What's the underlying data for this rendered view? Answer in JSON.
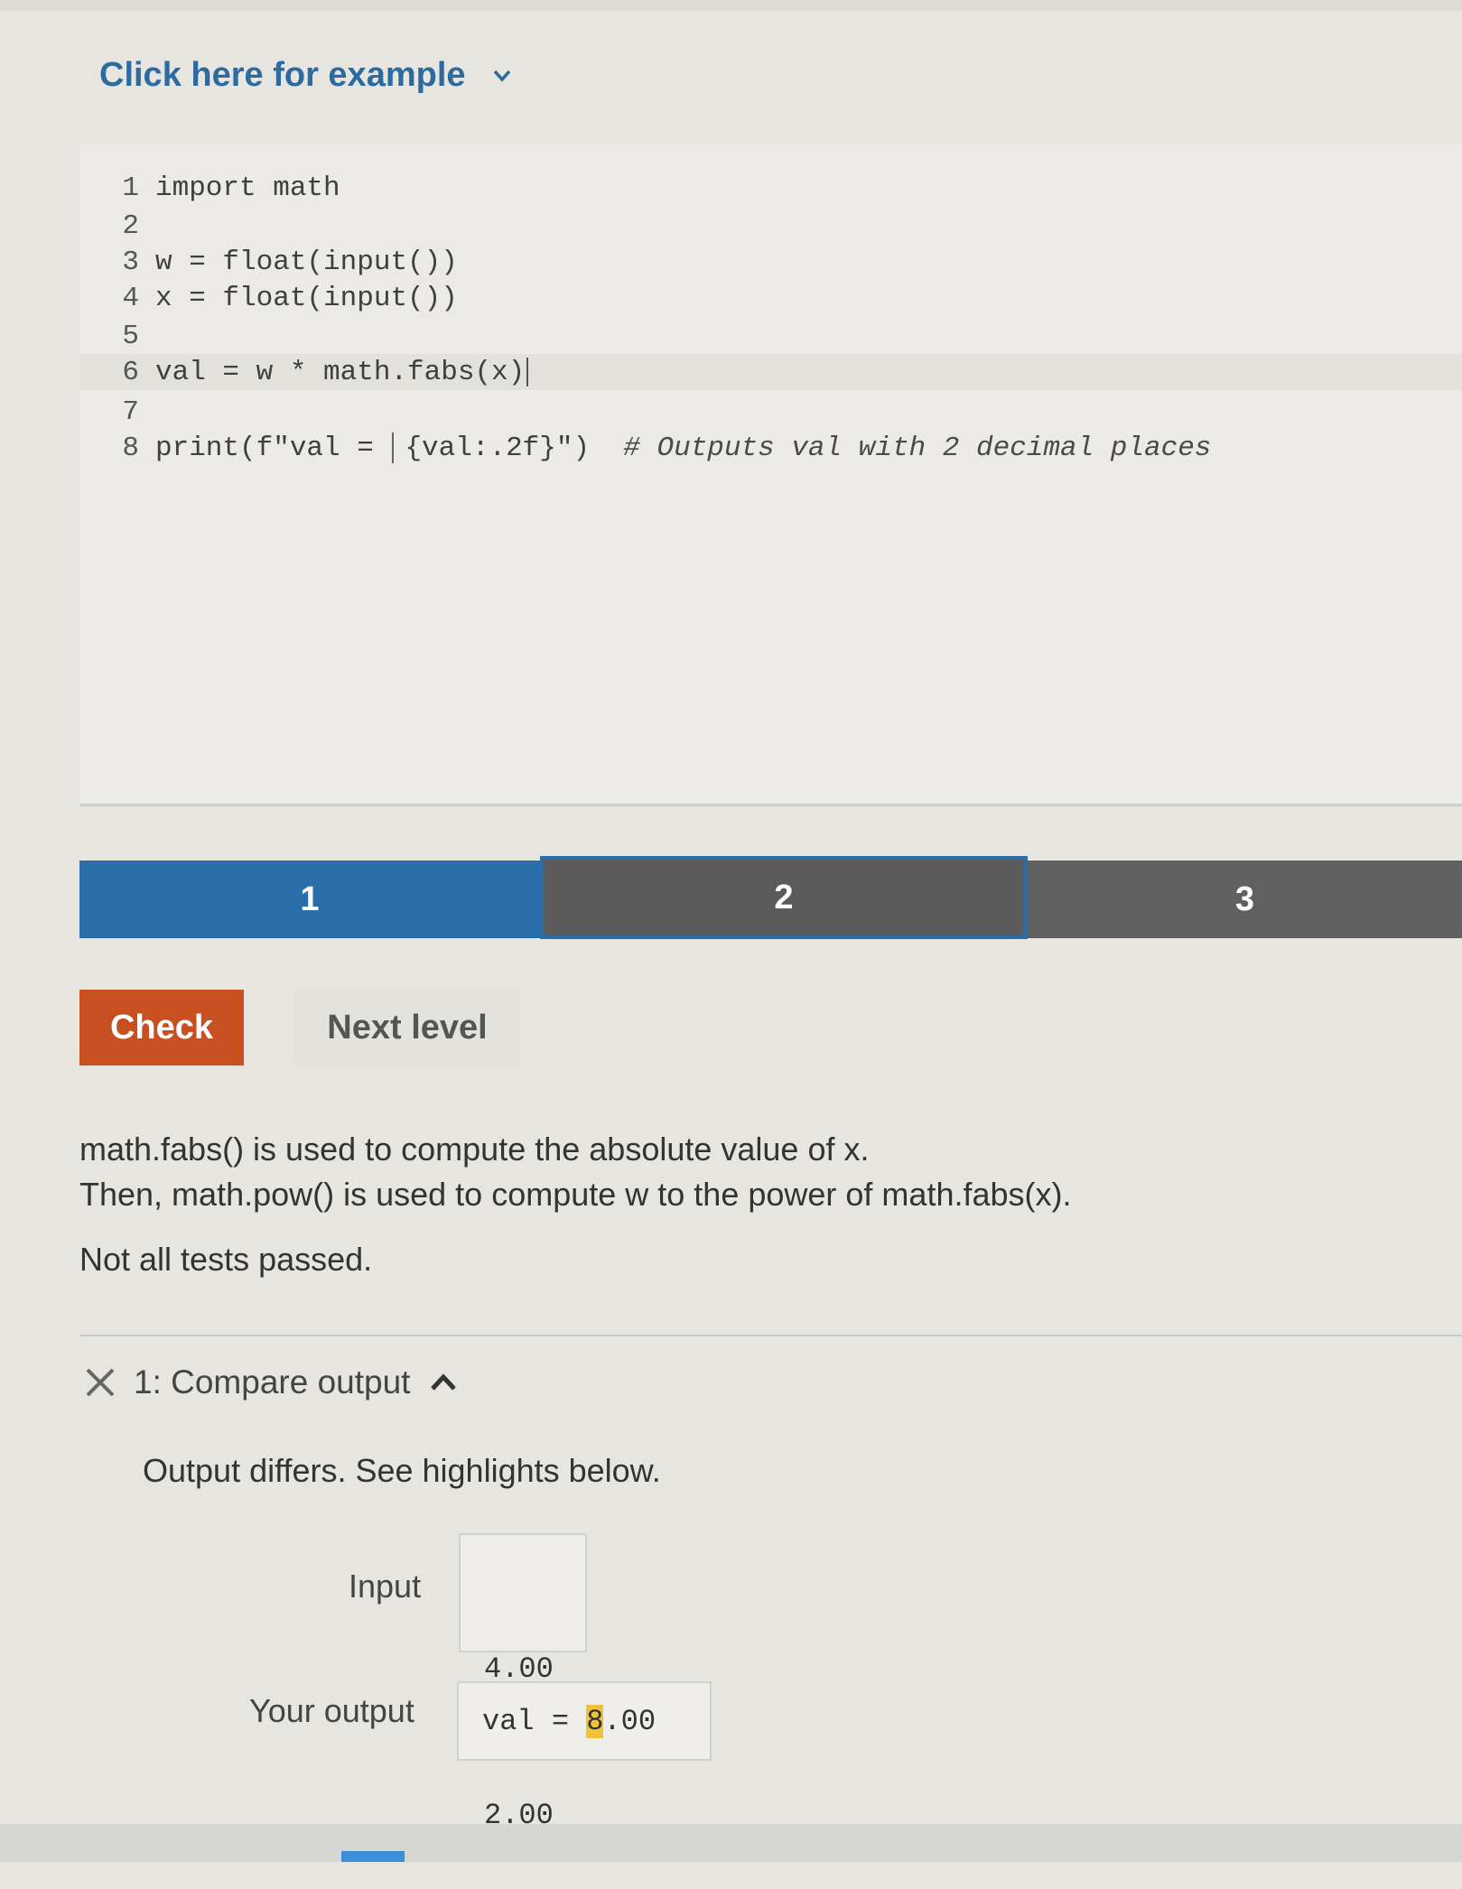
{
  "example": {
    "label": "Click here for example"
  },
  "editor": {
    "lines": [
      {
        "num": "1",
        "code": "import math"
      },
      {
        "num": "2",
        "code": ""
      },
      {
        "num": "3",
        "code": "w = float(input())"
      },
      {
        "num": "4",
        "code": "x = float(input())"
      },
      {
        "num": "5",
        "code": ""
      },
      {
        "num": "6",
        "code": "val = w * math.fabs(x)"
      },
      {
        "num": "7",
        "code": ""
      },
      {
        "num": "8",
        "code_a": "print(f\"val = ",
        "code_b": "{val:.2f}\")  ",
        "comment": "# Outputs val with 2 decimal places"
      }
    ]
  },
  "levels": [
    "1",
    "2",
    "3"
  ],
  "buttons": {
    "check": "Check",
    "next": "Next level"
  },
  "feedback": {
    "line1": "math.fabs() is used to compute the absolute value of x.",
    "line2": "Then, math.pow() is used to compute w to the power of math.fabs(x).",
    "status": "Not all tests passed."
  },
  "test": {
    "title": "1: Compare output",
    "message": "Output differs. See highlights below.",
    "input_label": "Input",
    "input_lines": [
      "4.00",
      "2.00"
    ],
    "output_label": "Your output",
    "output_prefix": "val = ",
    "output_highlight": "8",
    "output_suffix": ".00"
  },
  "colors": {
    "accent_blue": "#2a6dab",
    "check_orange": "#c84f1f",
    "diff_highlight": "#f0c23c"
  }
}
